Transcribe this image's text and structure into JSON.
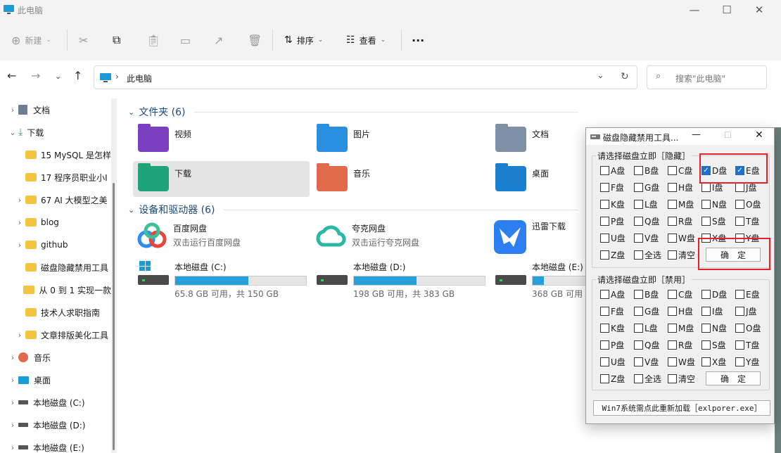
{
  "window": {
    "title": "此电脑"
  },
  "toolbar": {
    "new_label": "新建",
    "sort_label": "排序",
    "view_label": "查看",
    "more_label": "···"
  },
  "address": {
    "path": "此电脑",
    "search_placeholder": "搜索\"此电脑\""
  },
  "sidebar": {
    "items": [
      {
        "label": "文档",
        "type": "doc",
        "expand": "›"
      },
      {
        "label": "下载",
        "type": "download",
        "expand": "⌄"
      },
      {
        "label": "15 MySQL 是怎样",
        "type": "folder",
        "expand": ""
      },
      {
        "label": "17 程序员职业小Ⅰ",
        "type": "folder",
        "expand": ""
      },
      {
        "label": "67 AI 大模型之美",
        "type": "folder",
        "expand": "›"
      },
      {
        "label": "blog",
        "type": "folder",
        "expand": "›"
      },
      {
        "label": "github",
        "type": "folder",
        "expand": "›"
      },
      {
        "label": "磁盘隐藏禁用工具",
        "type": "folder",
        "expand": ""
      },
      {
        "label": "从 0 到 1 实现一款",
        "type": "folder",
        "expand": ""
      },
      {
        "label": "技术人求职指南",
        "type": "folder",
        "expand": ""
      },
      {
        "label": "文章排版美化工具",
        "type": "folder",
        "expand": "›"
      },
      {
        "label": "音乐",
        "type": "music",
        "expand": "›"
      },
      {
        "label": "桌面",
        "type": "desktop",
        "expand": "›"
      },
      {
        "label": "本地磁盘 (C:)",
        "type": "drive",
        "expand": "›"
      },
      {
        "label": "本地磁盘 (D:)",
        "type": "drive",
        "expand": "›"
      },
      {
        "label": "本地磁盘 (E:)",
        "type": "drive",
        "expand": "›"
      }
    ]
  },
  "main": {
    "folders_header": "文件夹 (6)",
    "folders": [
      {
        "label": "视频",
        "color": "#7b3fc4"
      },
      {
        "label": "图片",
        "color": "#2a8fe0"
      },
      {
        "label": "文档",
        "color": "#7f8fa6"
      },
      {
        "label": "下载",
        "color": "#1fa37a"
      },
      {
        "label": "音乐",
        "color": "#e06a4a"
      },
      {
        "label": "桌面",
        "color": "#1b7fd0"
      }
    ],
    "devices_header": "设备和驱动器 (6)",
    "apps": [
      {
        "name": "百度网盘",
        "desc": "双击运行百度网盘"
      },
      {
        "name": "夸克网盘",
        "desc": "双击运行夸克网盘"
      },
      {
        "name": "迅雷下载",
        "desc": ""
      }
    ],
    "drives": [
      {
        "name": "本地磁盘 (C:)",
        "free": "65.8 GB 可用，共 150 GB",
        "fill": 0.56
      },
      {
        "name": "本地磁盘 (D:)",
        "free": "198 GB 可用，共 383 GB",
        "fill": 0.48
      },
      {
        "name": "本地磁盘 (E:)",
        "free": "368 GB 可用",
        "fill": 0.2
      }
    ]
  },
  "dialog": {
    "title": "磁盘隐藏禁用工具...",
    "hide_legend": "请选择磁盘立即［隐藏］",
    "disable_legend": "请选择磁盘立即［禁用］",
    "drive_labels": [
      "A盘",
      "B盘",
      "C盘",
      "D盘",
      "E盘",
      "F盘",
      "G盘",
      "H盘",
      "I盘",
      "J盘",
      "K盘",
      "L盘",
      "M盘",
      "N盘",
      "O盘",
      "P盘",
      "Q盘",
      "R盘",
      "S盘",
      "T盘",
      "U盘",
      "V盘",
      "W盘",
      "X盘",
      "Y盘",
      "Z盘"
    ],
    "hide_checked": [
      "D盘",
      "E盘"
    ],
    "select_all": "全选",
    "clear": "清空",
    "ok": "确定",
    "reload": "Win7系统需点此重新加载［exlporer.exe］"
  },
  "colors": {
    "accent": "#26a0da",
    "checkbox": "#1f6fd0",
    "highlight": "#e8212a"
  }
}
